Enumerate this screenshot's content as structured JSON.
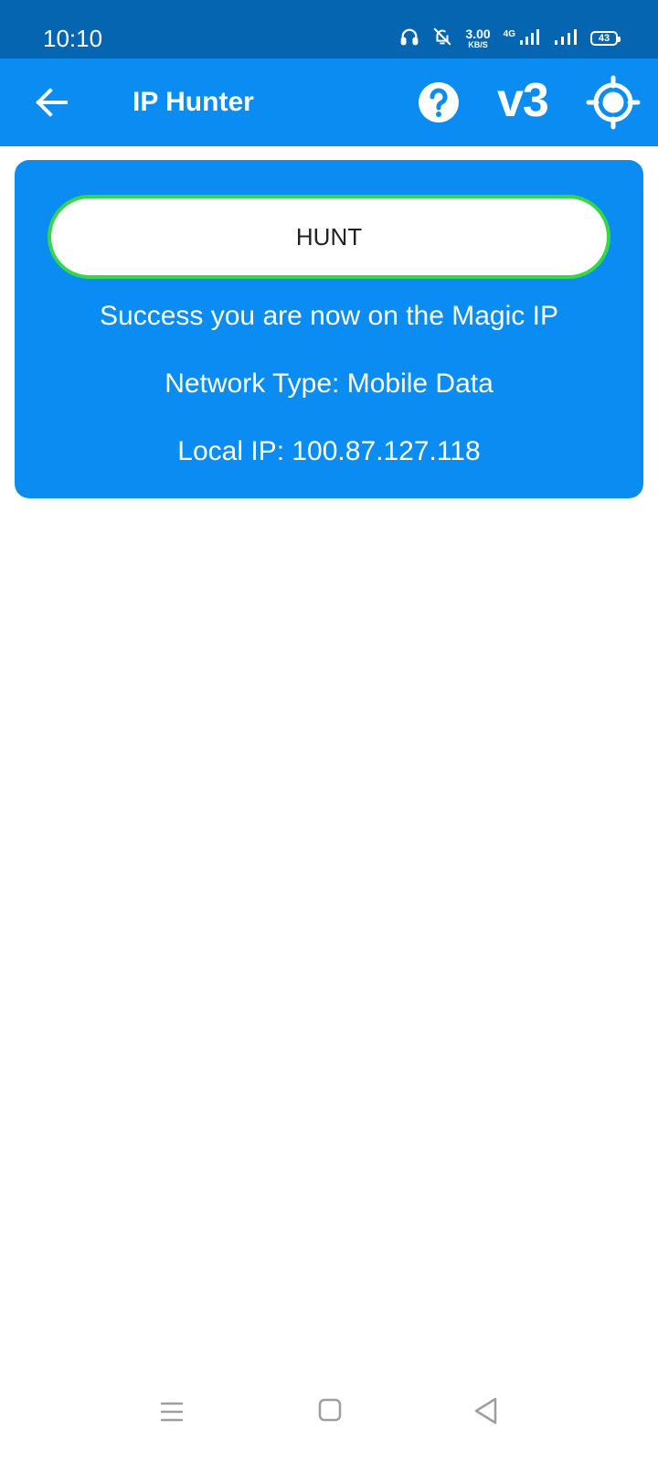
{
  "status_bar": {
    "time": "10:10",
    "speed_value": "3.00",
    "speed_unit": "KB/S",
    "network_label": "4G",
    "battery": "43",
    "icons": [
      "headset-icon",
      "bell-off-icon",
      "signal-icon",
      "signal-icon",
      "battery-icon"
    ]
  },
  "app_bar": {
    "title": "IP Hunter",
    "version": "v3",
    "icons": [
      "back-arrow-icon",
      "help-icon",
      "target-icon"
    ]
  },
  "card": {
    "button_label": "HUNT",
    "status": "Success you are now on the Magic IP",
    "network_type": "Network Type: Mobile Data",
    "local_ip": "Local IP: 100.87.127.118"
  },
  "nav_bar": {
    "icons": [
      "menu-icon",
      "home-icon",
      "back-triangle-icon"
    ]
  },
  "colors": {
    "status_bar": "#0565b0",
    "app_bar": "#0a8cf2",
    "card": "#0a8cf2",
    "button_border": "#36d649",
    "nav_icon": "#9e9e9e"
  }
}
